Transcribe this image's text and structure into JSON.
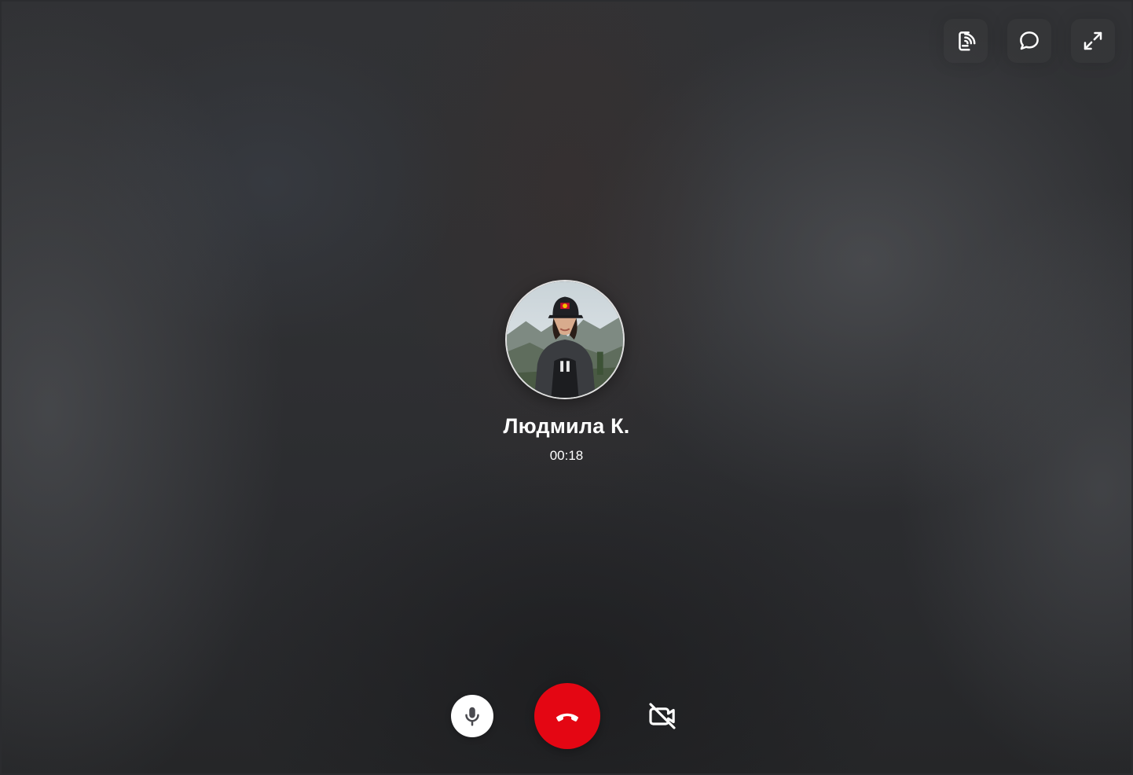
{
  "caller": {
    "name": "Людмила К.",
    "call_duration": "00:18",
    "avatar_alt": ""
  },
  "top_controls": [
    {
      "name": "screen-share-icon"
    },
    {
      "name": "chat-bubble-icon"
    },
    {
      "name": "fullscreen-icon"
    }
  ],
  "bottom_controls": {
    "mic": {
      "icon": "microphone-icon",
      "state": "on"
    },
    "hangup": {
      "icon": "phone-hangup-icon"
    },
    "camera": {
      "icon": "camera-off-icon",
      "state": "off"
    }
  },
  "colors": {
    "hangup": "#e40613",
    "background": "#2b2c2f",
    "icon": "#ffffff"
  }
}
